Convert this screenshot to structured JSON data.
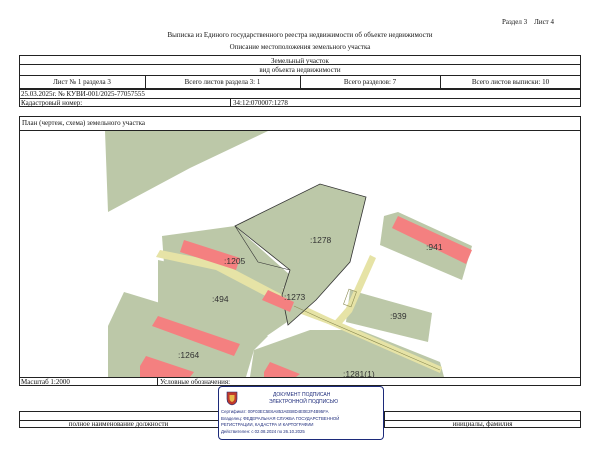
{
  "page_header": {
    "section": "Раздел 3",
    "sheet": "Лист 4"
  },
  "title": "Выписка из Единого государственного реестра недвижимости об объекте недвижимости",
  "subtitle": "Описание местоположения земельного участка",
  "object_name": "Земельный участок",
  "object_name_caption": "вид объекта недвижимости",
  "info_row": {
    "sheet_of_section": "Лист № 1 раздела 3",
    "sheets_in_section": "Всего листов раздела 3: 1",
    "sections_total": "Всего разделов: 7",
    "sheets_total": "Всего листов выписки: 10"
  },
  "doc_ref": "25.03.2025г. № КУВИ-001/2025-77057555",
  "cadastral_label": "Кадастровый номер:",
  "cadastral_number": "34:12:070007:1278",
  "plan_title": "План (чертеж, схема) земельного участка",
  "map": {
    "labels": {
      "p1278": ":1278",
      "p941": ":941",
      "p1205": ":1205",
      "p1273": ":1273",
      "p494": ":494",
      "p939": ":939",
      "p1264": ":1264",
      "p1281": ":1281(1)"
    },
    "colors": {
      "parcel_fill": "#bcc8a8",
      "building_fill": "#f48080",
      "road": "#e6e3a6",
      "outline": "#333333"
    }
  },
  "scale": "Масштаб 1:2000",
  "legend_label": "Условные обозначения:",
  "footer": {
    "position": "полное наименование должности",
    "signature_name": "инициалы, фамилия"
  },
  "stamp": {
    "line1": "ДОКУМЕНТ ПОДПИСАН",
    "line2": "ЭЛЕКТРОННОЙ ПОДПИСЬЮ",
    "cert_line": "Сертификат: 00F03EC5E6A853AEB8D4E0E2F4B95FA",
    "owner_line": "Владелец: ФЕДЕРАЛЬНАЯ СЛУЖБА ГОСУДАРСТВЕННОЙ",
    "owner_line2": "РЕГИСТРАЦИИ, КАДАСТРА И КАРТОГРАФИИ",
    "valid_line": "Действителен: с 02.08.2024 по 26.10.2025"
  }
}
